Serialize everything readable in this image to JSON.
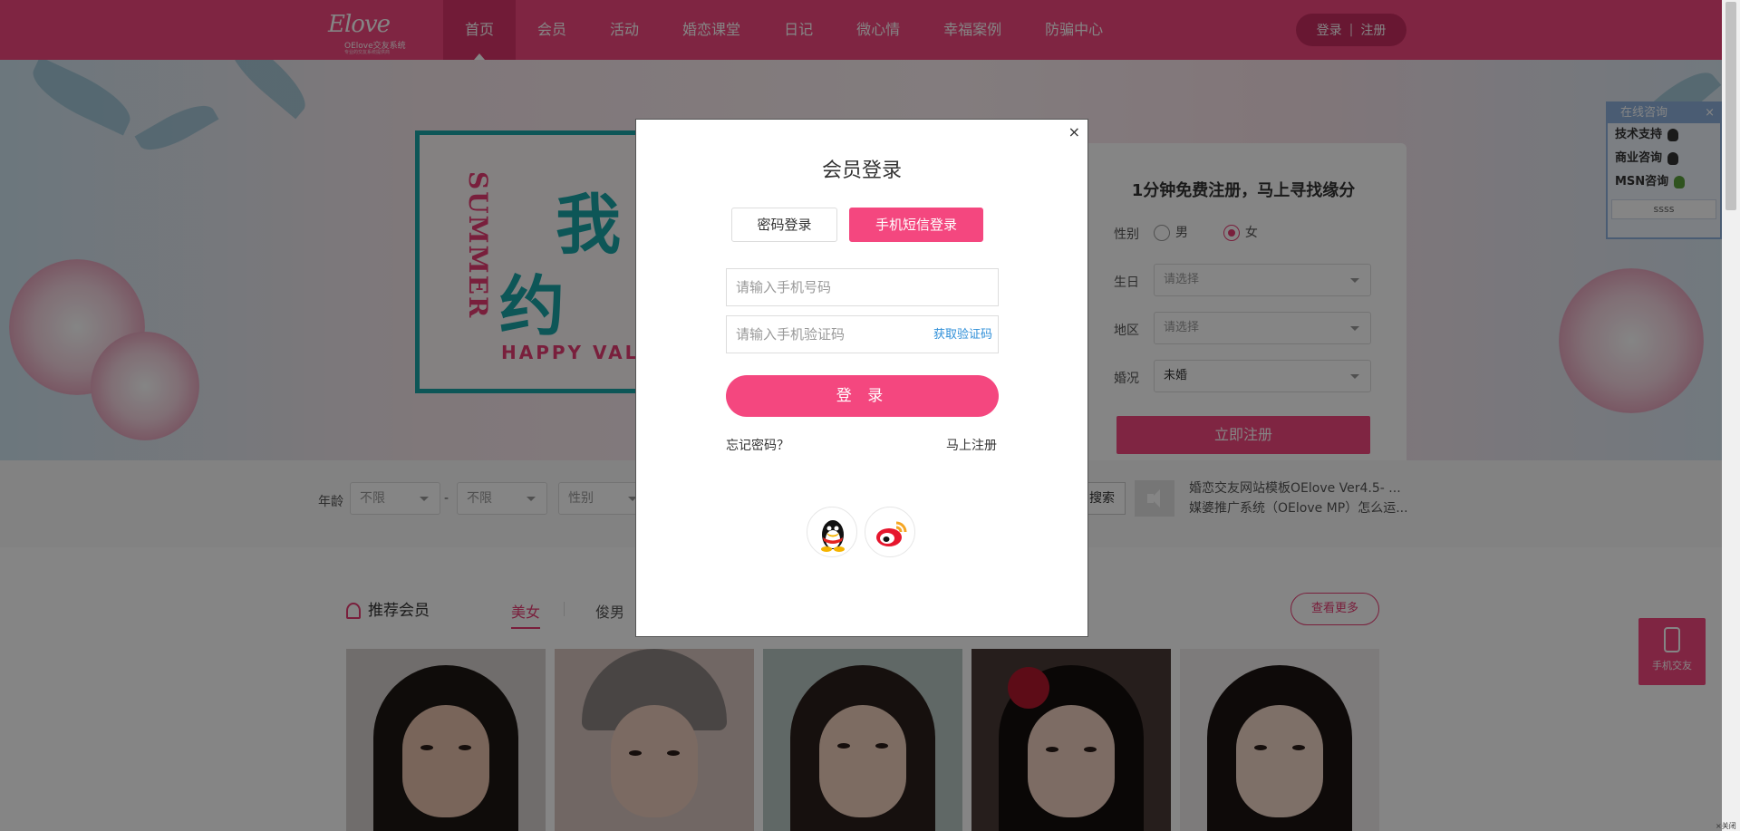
{
  "header": {
    "logo_script": "Elove",
    "logo_cn": "OElove交友系统",
    "logo_slogan": "专业的交友系统提供商",
    "nav": [
      "首页",
      "会员",
      "活动",
      "婚恋课堂",
      "日记",
      "微心情",
      "幸福案例",
      "防骗中心"
    ],
    "active_nav": "首页",
    "login_label": "登录",
    "separator": "|",
    "register_label": "注册",
    "brand_color": "#f4477f"
  },
  "banner": {
    "poster_vertical": "SUMMER",
    "poster_big1": "我",
    "poster_big2": "约",
    "poster_happy": "HAPPY VAL"
  },
  "register_card": {
    "title": "1分钟免费注册，马上寻找缘分",
    "gender_label": "性别",
    "male": "男",
    "female": "女",
    "selected_gender": "女",
    "birthday_label": "生日",
    "birthday_value": "请选择",
    "region_label": "地区",
    "region_value": "请选择",
    "marital_label": "婚况",
    "marital_value": "未婚",
    "submit_label": "立即注册"
  },
  "consult": {
    "title": "在线咨询",
    "close": "×",
    "items": [
      "技术支持",
      "商业咨询",
      "MSN咨询"
    ],
    "footer": "ssss"
  },
  "search_strip": {
    "age_label": "年龄",
    "age_min": "不限",
    "dash": "-",
    "age_max": "不限",
    "gender_placeholder": "性别",
    "search_label": "搜索",
    "news": [
      "婚恋交友网站模板OElove Ver4.5- ...",
      "媒婆推广系统（OElove MP）怎么运..."
    ]
  },
  "recommend": {
    "title": "推荐会员",
    "tab_female": "美女",
    "tab_male": "俊男",
    "more_label": "查看更多"
  },
  "mobile_badge": "手机交友",
  "corner_close": "×关闭",
  "modal": {
    "close": "×",
    "title": "会员登录",
    "tab_password": "密码登录",
    "tab_sms": "手机短信登录",
    "phone_placeholder": "请输入手机号码",
    "code_placeholder": "请输入手机验证码",
    "get_code": "获取验证码",
    "login_label": "登 录",
    "forgot": "忘记密码？",
    "register_now": "马上注册",
    "social": [
      "qq-icon",
      "weibo-icon"
    ]
  }
}
